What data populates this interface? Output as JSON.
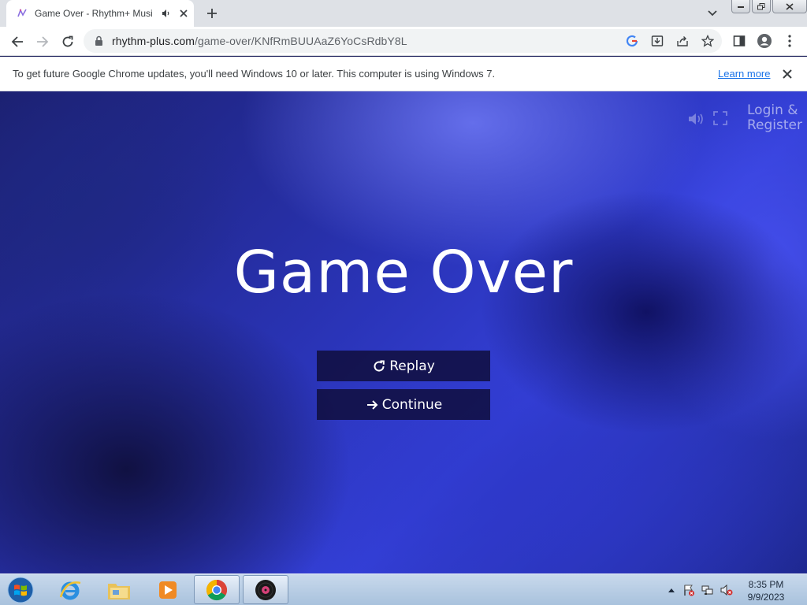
{
  "browser": {
    "tab": {
      "title": "Game Over - Rhythm+ Music",
      "favicon": "rhythm-plus-icon"
    },
    "address": {
      "host": "rhythm-plus.com",
      "path": "/game-over/KNfRmBUUAaZ6YoCsRdbY8L"
    }
  },
  "infobar": {
    "message": "To get future Google Chrome updates, you'll need Windows 10 or later. This computer is using Windows 7.",
    "learn_more": "Learn more"
  },
  "page": {
    "login_line1": "Login &",
    "login_line2": "Register",
    "headline": "Game Over",
    "replay_label": "Replay",
    "continue_label": "Continue"
  },
  "taskbar": {
    "apps": [
      "internet-explorer",
      "file-explorer",
      "media-player",
      "chrome",
      "rhythm-plus"
    ],
    "time": "8:35 PM",
    "date": "9/9/2023"
  },
  "colors": {
    "accent_blue": "#1a73e8",
    "page_bg": "#2a34b8",
    "button_bg": "#0f0c37"
  }
}
